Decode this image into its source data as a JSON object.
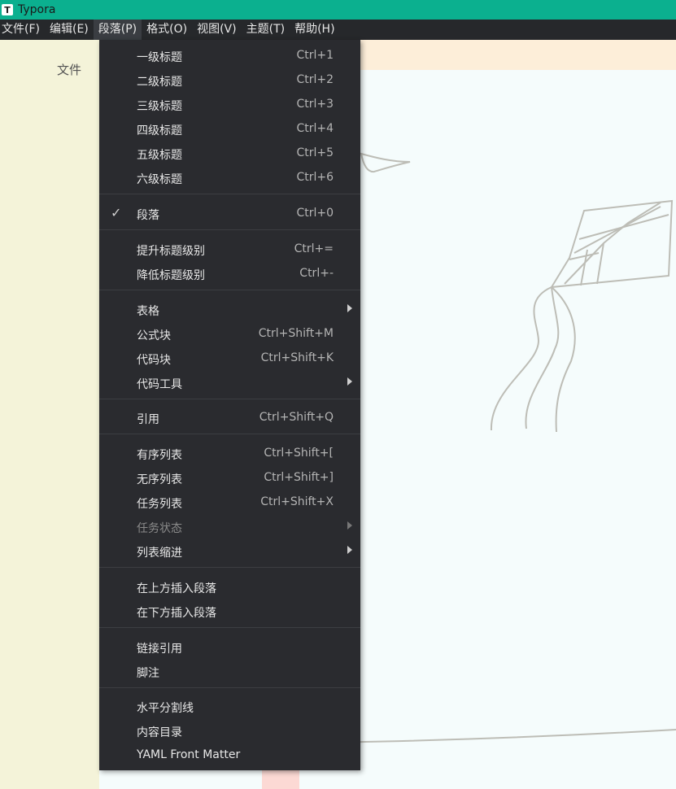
{
  "titlebar": {
    "app_icon": "T",
    "title": "Typora"
  },
  "menubar": [
    "文件(F)",
    "编辑(E)",
    "段落(P)",
    "格式(O)",
    "视图(V)",
    "主题(T)",
    "帮助(H)"
  ],
  "sidebar": {
    "label": "文件"
  },
  "menu": {
    "headings": [
      {
        "label": "一级标题",
        "shortcut": "Ctrl+1"
      },
      {
        "label": "二级标题",
        "shortcut": "Ctrl+2"
      },
      {
        "label": "三级标题",
        "shortcut": "Ctrl+3"
      },
      {
        "label": "四级标题",
        "shortcut": "Ctrl+4"
      },
      {
        "label": "五级标题",
        "shortcut": "Ctrl+5"
      },
      {
        "label": "六级标题",
        "shortcut": "Ctrl+6"
      }
    ],
    "paragraph": {
      "label": "段落",
      "shortcut": "Ctrl+0",
      "checked": true
    },
    "level": [
      {
        "label": "提升标题级别",
        "shortcut": "Ctrl+="
      },
      {
        "label": "降低标题级别",
        "shortcut": "Ctrl+-"
      }
    ],
    "blocks": [
      {
        "label": "表格",
        "submenu": true
      },
      {
        "label": "公式块",
        "shortcut": "Ctrl+Shift+M"
      },
      {
        "label": "代码块",
        "shortcut": "Ctrl+Shift+K"
      },
      {
        "label": "代码工具",
        "submenu": true
      }
    ],
    "quote": {
      "label": "引用",
      "shortcut": "Ctrl+Shift+Q"
    },
    "lists": [
      {
        "label": "有序列表",
        "shortcut": "Ctrl+Shift+["
      },
      {
        "label": "无序列表",
        "shortcut": "Ctrl+Shift+]"
      },
      {
        "label": "任务列表",
        "shortcut": "Ctrl+Shift+X"
      },
      {
        "label": "任务状态",
        "submenu": true,
        "disabled": true
      },
      {
        "label": "列表缩进",
        "submenu": true
      }
    ],
    "insert": [
      {
        "label": "在上方插入段落"
      },
      {
        "label": "在下方插入段落"
      }
    ],
    "refs": [
      {
        "label": "链接引用"
      },
      {
        "label": "脚注"
      }
    ],
    "misc": [
      {
        "label": "水平分割线"
      },
      {
        "label": "内容目录"
      },
      {
        "label": "YAML Front Matter"
      }
    ]
  },
  "colors": {
    "titlebar": "#0bb08f",
    "menu_bg": "#2a2b2f",
    "menubar_bg": "#26282b"
  }
}
